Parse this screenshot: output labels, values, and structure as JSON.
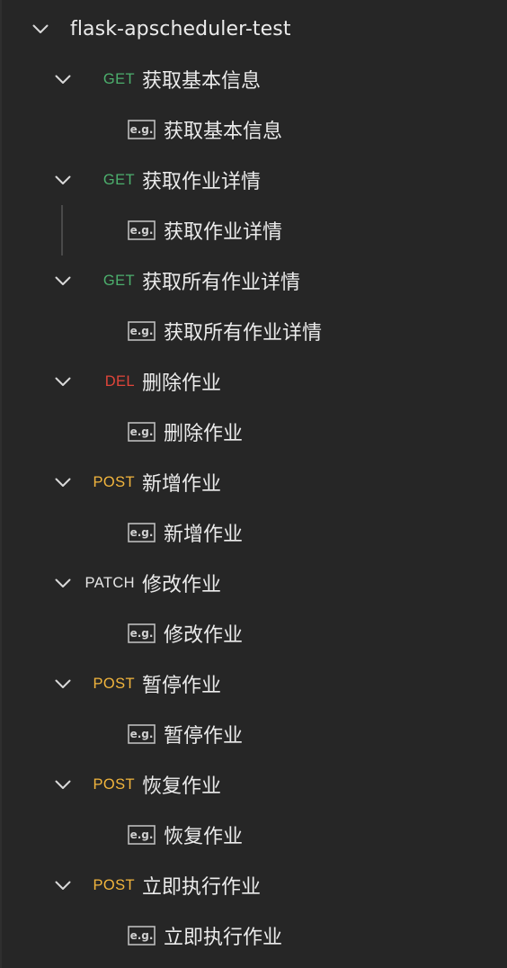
{
  "collection": {
    "name": "flask-apscheduler-test"
  },
  "colors": {
    "GET": "#4caf6d",
    "DEL": "#e0453a",
    "POST": "#f2b53d",
    "PATCH": "#e6e6e6"
  },
  "example_badge": "e.g.",
  "requests": [
    {
      "method": "GET",
      "name": "获取基本信息",
      "example": "获取基本信息"
    },
    {
      "method": "GET",
      "name": "获取作业详情",
      "example": "获取作业详情"
    },
    {
      "method": "GET",
      "name": "获取所有作业详情",
      "example": "获取所有作业详情"
    },
    {
      "method": "DEL",
      "name": "删除作业",
      "example": "删除作业"
    },
    {
      "method": "POST",
      "name": "新增作业",
      "example": "新增作业"
    },
    {
      "method": "PATCH",
      "name": "修改作业",
      "example": "修改作业"
    },
    {
      "method": "POST",
      "name": "暂停作业",
      "example": "暂停作业"
    },
    {
      "method": "POST",
      "name": "恢复作业",
      "example": "恢复作业"
    },
    {
      "method": "POST",
      "name": "立即执行作业",
      "example": "立即执行作业"
    }
  ]
}
